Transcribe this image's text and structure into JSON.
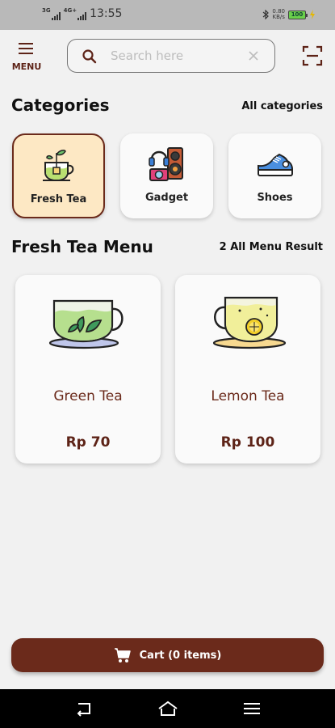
{
  "status_bar": {
    "net1": "3G",
    "net2": "4G+",
    "time": "13:55",
    "speed_value": "0.80",
    "speed_unit": "KB/s",
    "battery": "100"
  },
  "header": {
    "menu_label": "MENU",
    "search_placeholder": "Search here",
    "search_value": ""
  },
  "categories": {
    "title": "Categories",
    "link": "All categories",
    "items": [
      {
        "label": "Fresh Tea",
        "icon": "tea-cup-icon",
        "active": true
      },
      {
        "label": "Gadget",
        "icon": "gadget-icon",
        "active": false
      },
      {
        "label": "Shoes",
        "icon": "sneaker-icon",
        "active": false
      }
    ]
  },
  "menu_section": {
    "title": "Fresh Tea Menu",
    "result": "2 All Menu Result",
    "products": [
      {
        "name": "Green Tea",
        "price": "Rp 70",
        "icon": "green-tea-icon"
      },
      {
        "name": "Lemon Tea",
        "price": "Rp 100",
        "icon": "lemon-tea-icon"
      }
    ]
  },
  "cart": {
    "label": "Cart (0 items)"
  },
  "colors": {
    "brand": "#6b2a1b",
    "active_category_bg": "#fde8c4",
    "background": "#f1f1f1"
  }
}
